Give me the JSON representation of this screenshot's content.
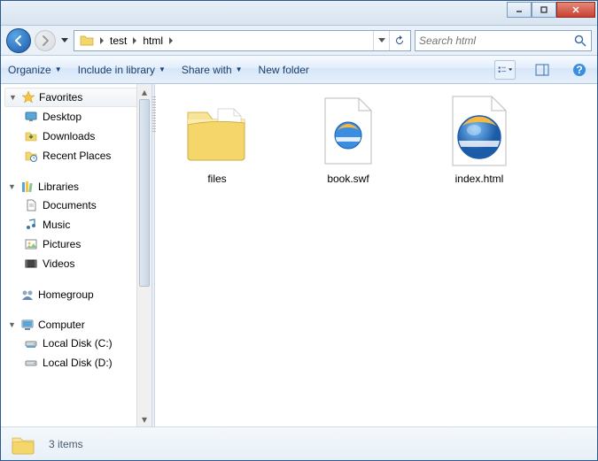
{
  "window_controls": {
    "min": "minimize",
    "max": "maximize",
    "close": "close"
  },
  "breadcrumb": {
    "segments": [
      "test",
      "html"
    ]
  },
  "search": {
    "placeholder": "Search html"
  },
  "toolbar": {
    "organize": "Organize",
    "include": "Include in library",
    "share": "Share with",
    "newfolder": "New folder"
  },
  "sidebar": {
    "favorites": {
      "label": "Favorites",
      "items": [
        {
          "label": "Desktop",
          "icon": "desktop-icon"
        },
        {
          "label": "Downloads",
          "icon": "downloads-icon"
        },
        {
          "label": "Recent Places",
          "icon": "recent-icon"
        }
      ]
    },
    "libraries": {
      "label": "Libraries",
      "items": [
        {
          "label": "Documents",
          "icon": "documents-icon"
        },
        {
          "label": "Music",
          "icon": "music-icon"
        },
        {
          "label": "Pictures",
          "icon": "pictures-icon"
        },
        {
          "label": "Videos",
          "icon": "videos-icon"
        }
      ]
    },
    "homegroup": {
      "label": "Homegroup"
    },
    "computer": {
      "label": "Computer",
      "items": [
        {
          "label": "Local Disk (C:)",
          "icon": "disk-icon"
        },
        {
          "label": "Local Disk (D:)",
          "icon": "disk-icon"
        }
      ]
    }
  },
  "files": [
    {
      "name": "files",
      "type": "folder"
    },
    {
      "name": "book.swf",
      "type": "ie-file"
    },
    {
      "name": "index.html",
      "type": "ie-file-large"
    }
  ],
  "status": {
    "text": "3 items"
  }
}
